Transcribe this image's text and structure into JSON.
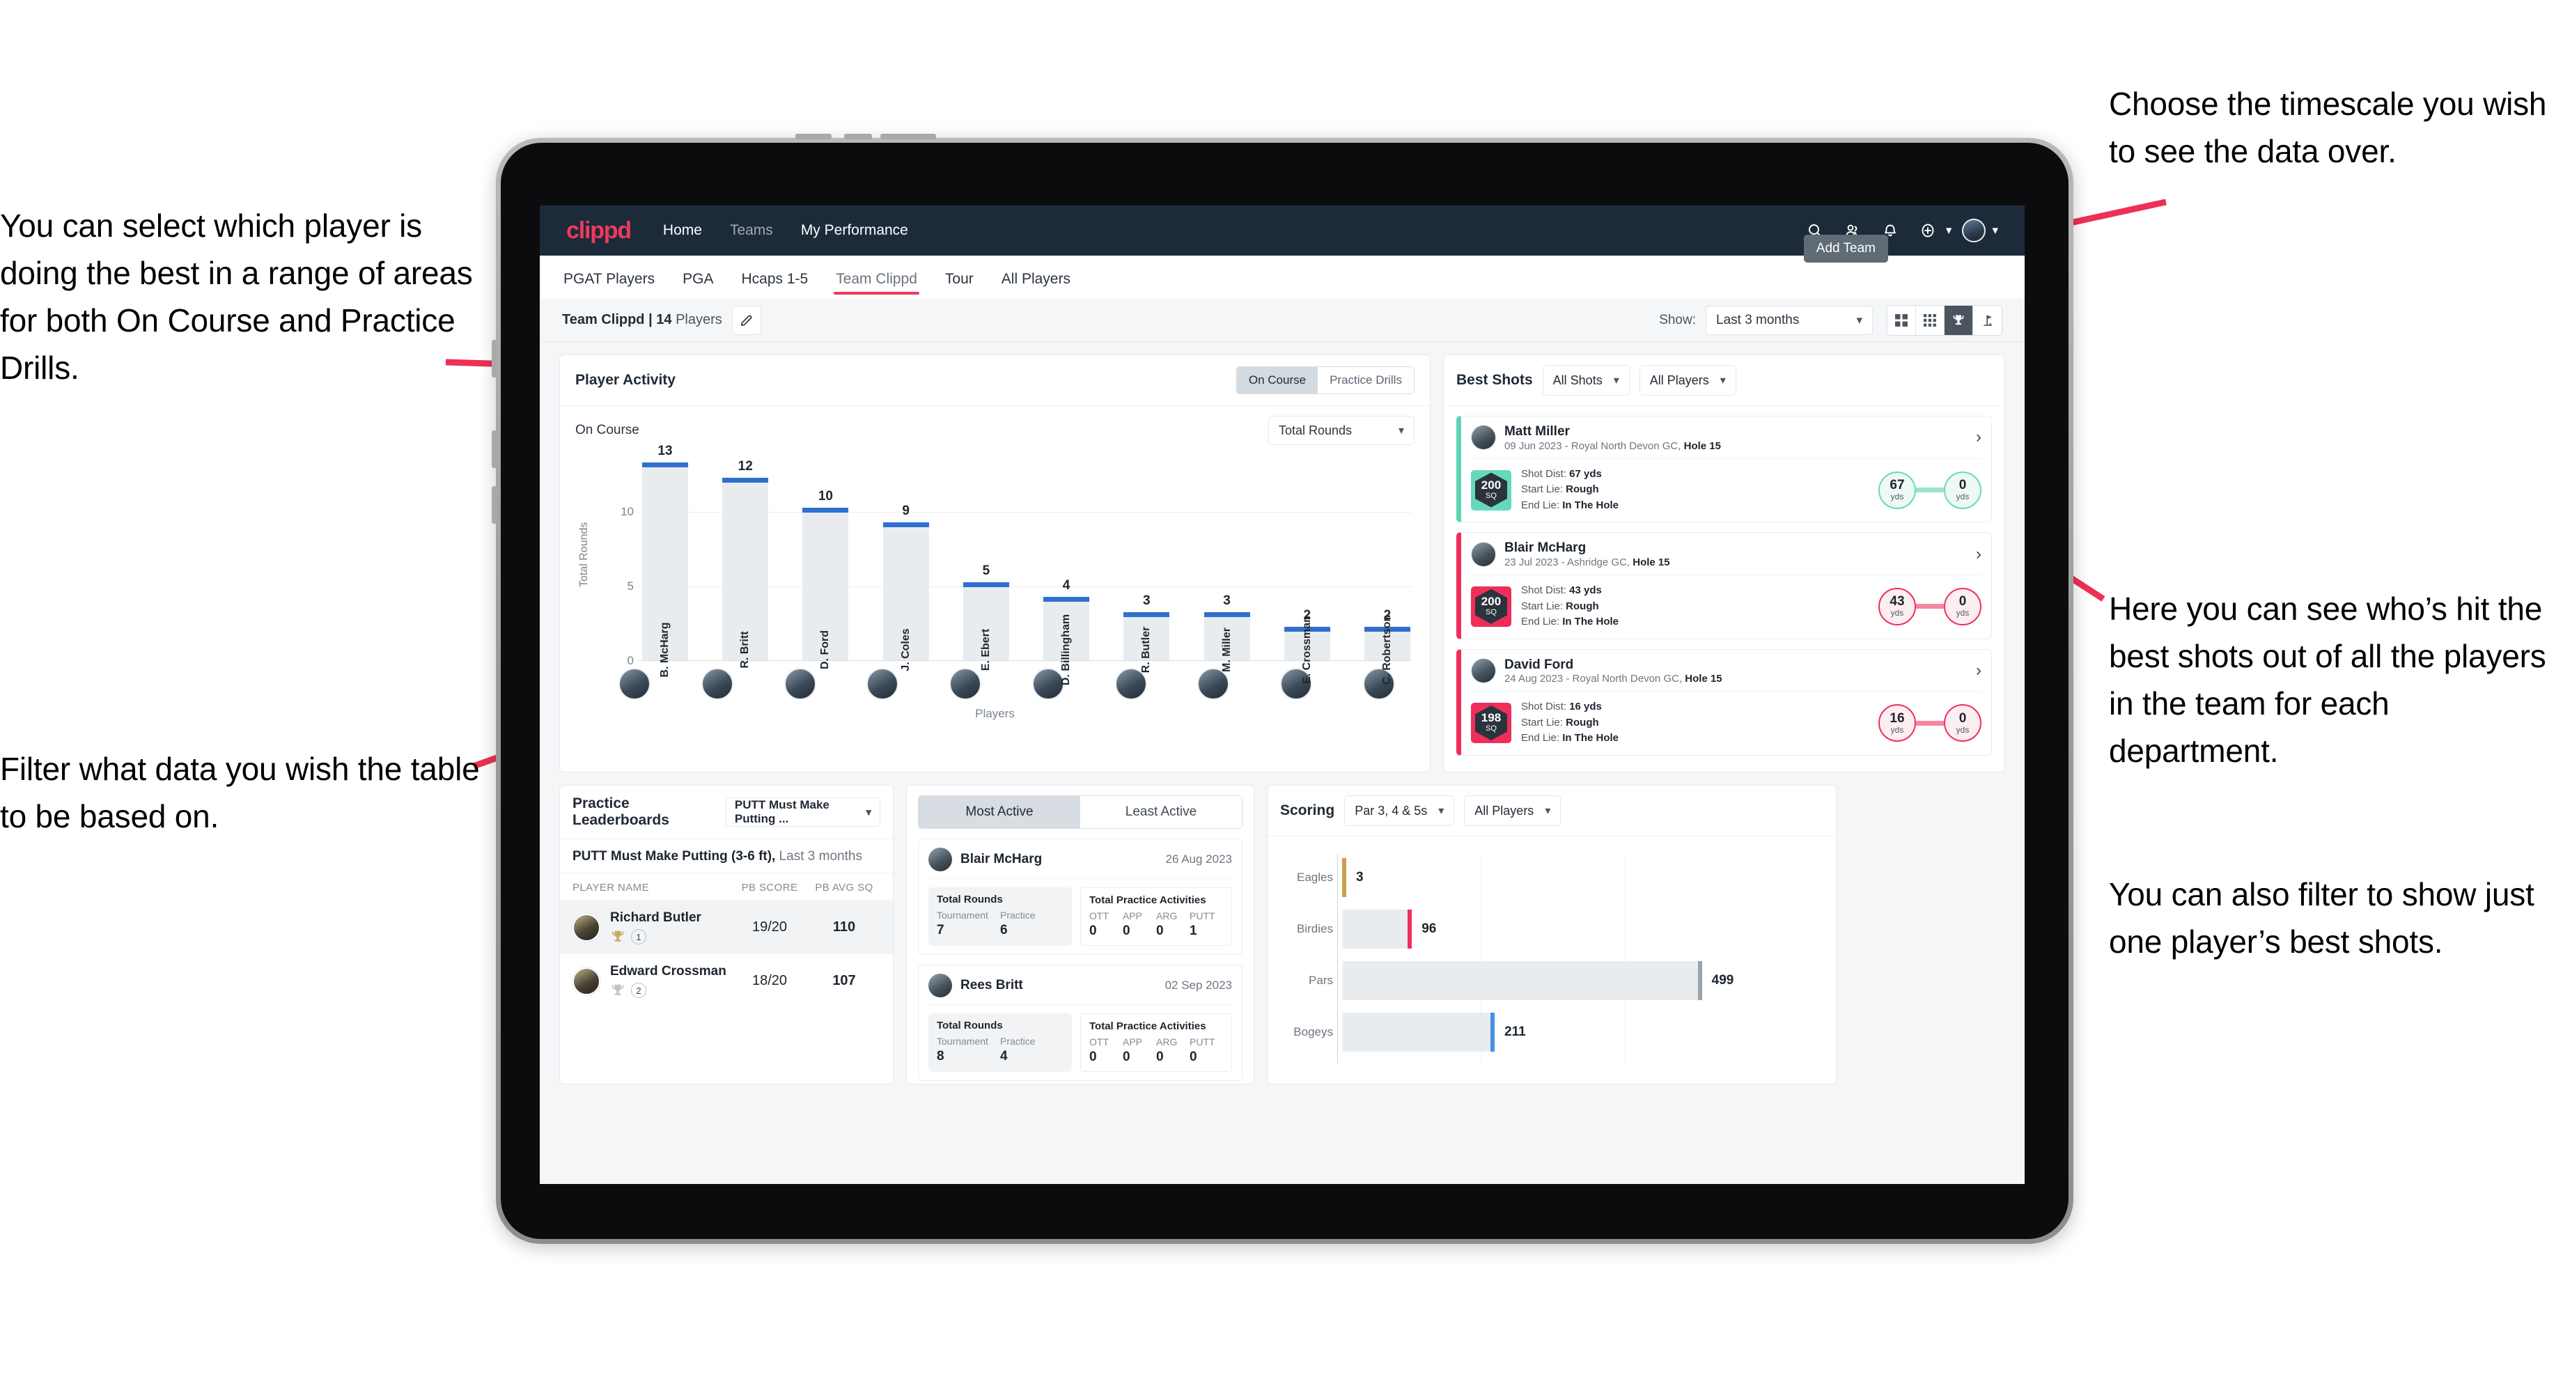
{
  "annotations": {
    "left_top": "You can select which player is doing the best in a range of areas for both On Course and Practice Drills.",
    "left_bottom": "Filter what data you wish the table to be based on.",
    "right_top": "Choose the timescale you wish to see the data over.",
    "right_middle": "Here you can see who’s hit the best shots out of all the players in the team for each department.",
    "right_bottom": "You can also filter to show just one player’s best shots."
  },
  "topnav": {
    "brand": "clippd",
    "links": [
      "Home",
      "Teams",
      "My Performance"
    ],
    "icons": [
      "search-icon",
      "people-icon",
      "bell-icon",
      "plus-circle-icon",
      "avatar-icon"
    ]
  },
  "tabbar": {
    "tabs": [
      "PGAT Players",
      "PGA",
      "Hcaps 1-5",
      "Team Clippd",
      "Tour",
      "All Players"
    ],
    "active": "Team Clippd",
    "tooltip": "Add Team"
  },
  "subheader": {
    "team_name": "Team Clippd",
    "player_count": "14",
    "players_word": "Players",
    "edit_icon": "pencil-icon",
    "show_label": "Show:",
    "timescale_value": "Last 3 months",
    "view_icons": [
      "grid-large-icon",
      "grid-small-icon",
      "trophy-icon",
      "flag-icon"
    ],
    "view_selected_index": 2
  },
  "player_activity": {
    "title": "Player Activity",
    "segments": [
      "On Course",
      "Practice Drills"
    ],
    "segment_active": "On Course",
    "sub_label": "On Course",
    "metric_value": "Total Rounds"
  },
  "chart_data": {
    "type": "bar",
    "title": "Player Activity - On Course",
    "xlabel": "Players",
    "ylabel": "Total Rounds",
    "categories": [
      "B. McHarg",
      "R. Britt",
      "D. Ford",
      "J. Coles",
      "E. Ebert",
      "D. Billingham",
      "R. Butler",
      "M. Miller",
      "E. Crossman",
      "C. Robertson"
    ],
    "values": [
      13,
      12,
      10,
      9,
      5,
      4,
      3,
      3,
      2,
      2
    ],
    "ylim": [
      0,
      14
    ],
    "yticks": [
      0,
      5,
      10
    ],
    "grid": true,
    "bar_color": "#e9ecef",
    "cap_color": "#2f6fd0"
  },
  "best_shots": {
    "title": "Best Shots",
    "filter_shots": "All Shots",
    "filter_players": "All Players",
    "shots": [
      {
        "player": "Matt Miller",
        "meta_date": "09 Jun 2023 - Royal North Devon GC,",
        "meta_hole": "Hole 15",
        "badge_value": "200",
        "badge_unit": "SQ",
        "accent": "#66d9bb",
        "shot_dist_label": "Shot Dist:",
        "shot_dist": "67 yds",
        "start_lie_label": "Start Lie:",
        "start_lie": "Rough",
        "end_lie_label": "End Lie:",
        "end_lie": "In The Hole",
        "from_value": "67",
        "from_unit": "yds",
        "to_value": "0",
        "to_unit": "yds"
      },
      {
        "player": "Blair McHarg",
        "meta_date": "23 Jul 2023 - Ashridge GC,",
        "meta_hole": "Hole 15",
        "badge_value": "200",
        "badge_unit": "SQ",
        "accent": "#ef2e5b",
        "shot_dist_label": "Shot Dist:",
        "shot_dist": "43 yds",
        "start_lie_label": "Start Lie:",
        "start_lie": "Rough",
        "end_lie_label": "End Lie:",
        "end_lie": "In The Hole",
        "from_value": "43",
        "from_unit": "yds",
        "to_value": "0",
        "to_unit": "yds"
      },
      {
        "player": "David Ford",
        "meta_date": "24 Aug 2023 - Royal North Devon GC,",
        "meta_hole": "Hole 15",
        "badge_value": "198",
        "badge_unit": "SQ",
        "accent": "#ef2e5b",
        "shot_dist_label": "Shot Dist:",
        "shot_dist": "16 yds",
        "start_lie_label": "Start Lie:",
        "start_lie": "Rough",
        "end_lie_label": "End Lie:",
        "end_lie": "In The Hole",
        "from_value": "16",
        "from_unit": "yds",
        "to_value": "0",
        "to_unit": "yds"
      }
    ]
  },
  "practice_leaderboards": {
    "title": "Practice Leaderboards",
    "drill_select": "PUTT Must Make Putting ...",
    "subtitle_bold": "PUTT Must Make Putting (3-6 ft),",
    "subtitle_rest": "Last 3 months",
    "columns": [
      "PLAYER NAME",
      "PB SCORE",
      "PB AVG SQ"
    ],
    "rows": [
      {
        "name": "Richard Butler",
        "rank": "1",
        "trophy": "gold",
        "pb_score": "19/20",
        "pb_avg_sq": "110"
      },
      {
        "name": "Edward Crossman",
        "rank": "2",
        "trophy": "silver",
        "pb_score": "18/20",
        "pb_avg_sq": "107"
      }
    ]
  },
  "activity_panel": {
    "tabs": [
      "Most Active",
      "Least Active"
    ],
    "active_tab": "Most Active",
    "rounds_title": "Total Rounds",
    "rounds_keys": [
      "Tournament",
      "Practice"
    ],
    "practice_title": "Total Practice Activities",
    "practice_keys": [
      "OTT",
      "APP",
      "ARG",
      "PUTT"
    ],
    "cards": [
      {
        "name": "Blair McHarg",
        "date": "26 Aug 2023",
        "rounds": [
          "7",
          "6"
        ],
        "practice": [
          "0",
          "0",
          "0",
          "1"
        ]
      },
      {
        "name": "Rees Britt",
        "date": "02 Sep 2023",
        "rounds": [
          "8",
          "4"
        ],
        "practice": [
          "0",
          "0",
          "0",
          "0"
        ]
      }
    ]
  },
  "scoring": {
    "title": "Scoring",
    "filter_par": "Par 3, 4 & 5s",
    "filter_players": "All Players"
  },
  "scoring_chart": {
    "type": "bar",
    "orientation": "horizontal",
    "title": "Scoring",
    "categories": [
      "Eagles",
      "Birdies",
      "Pars",
      "Bogeys"
    ],
    "values": [
      3,
      96,
      499,
      211
    ],
    "colors": [
      "#c9a14a",
      "#ef2e5b",
      "#9aa3ad",
      "#4a90e2"
    ],
    "xlim": [
      0,
      600
    ],
    "grid": true
  }
}
